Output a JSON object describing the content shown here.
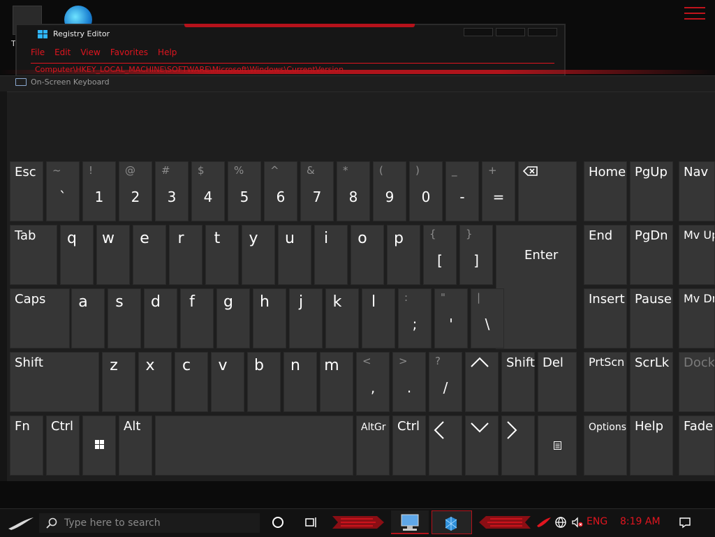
{
  "desktop": {
    "icon_label": "T"
  },
  "regedit": {
    "title": "Registry Editor",
    "menu": [
      "File",
      "Edit",
      "View",
      "Favorites",
      "Help"
    ],
    "address": "Computer\\HKEY_LOCAL_MACHINE\\SOFTWARE\\Microsoft\\Windows\\CurrentVersion"
  },
  "osk": {
    "title": "On-Screen Keyboard",
    "keys": {
      "esc": "Esc",
      "backspace_icon": "backspace-icon",
      "tab": "Tab",
      "enter": "Enter",
      "caps": "Caps",
      "shift": "Shift",
      "shift_right": "Shift",
      "del": "Del",
      "fn": "Fn",
      "ctrl": "Ctrl",
      "alt": "Alt",
      "altgr": "AltGr",
      "ctrl_right": "Ctrl",
      "home": "Home",
      "pgup": "PgUp",
      "nav": "Nav",
      "end": "End",
      "pgdn": "PgDn",
      "mvup": "Mv Up",
      "insert": "Insert",
      "pause": "Pause",
      "mvdn": "Mv Dn",
      "prtscn": "PrtScn",
      "scrlk": "ScrLk",
      "dock": "Dock",
      "options": "Options",
      "help": "Help",
      "fade": "Fade"
    },
    "number_row": [
      {
        "shift": "~",
        "main": "`"
      },
      {
        "shift": "!",
        "main": "1"
      },
      {
        "shift": "@",
        "main": "2"
      },
      {
        "shift": "#",
        "main": "3"
      },
      {
        "shift": "$",
        "main": "4"
      },
      {
        "shift": "%",
        "main": "5"
      },
      {
        "shift": "^",
        "main": "6"
      },
      {
        "shift": "&",
        "main": "7"
      },
      {
        "shift": "*",
        "main": "8"
      },
      {
        "shift": "(",
        "main": "9"
      },
      {
        "shift": ")",
        "main": "0"
      },
      {
        "shift": "_",
        "main": "-"
      },
      {
        "shift": "+",
        "main": "="
      }
    ],
    "row_q": [
      "q",
      "w",
      "e",
      "r",
      "t",
      "y",
      "u",
      "i",
      "o",
      "p"
    ],
    "row_q_sym": [
      {
        "shift": "{",
        "main": "["
      },
      {
        "shift": "}",
        "main": "]"
      }
    ],
    "row_a": [
      "a",
      "s",
      "d",
      "f",
      "g",
      "h",
      "j",
      "k",
      "l"
    ],
    "row_a_sym": [
      {
        "shift": ":",
        "main": ";"
      },
      {
        "shift": "\"",
        "main": "'"
      },
      {
        "shift": "|",
        "main": "\\"
      }
    ],
    "row_z": [
      "z",
      "x",
      "c",
      "v",
      "b",
      "n",
      "m"
    ],
    "row_z_sym": [
      {
        "shift": "<",
        "main": ","
      },
      {
        "shift": ">",
        "main": "."
      },
      {
        "shift": "?",
        "main": "/"
      }
    ]
  },
  "taskbar": {
    "search_placeholder": "Type here to search",
    "language": "ENG",
    "time": "8:19 AM"
  },
  "colors": {
    "accent": "#e0151f",
    "key_bg": "#363636",
    "panel_bg": "#1e1e1e"
  }
}
